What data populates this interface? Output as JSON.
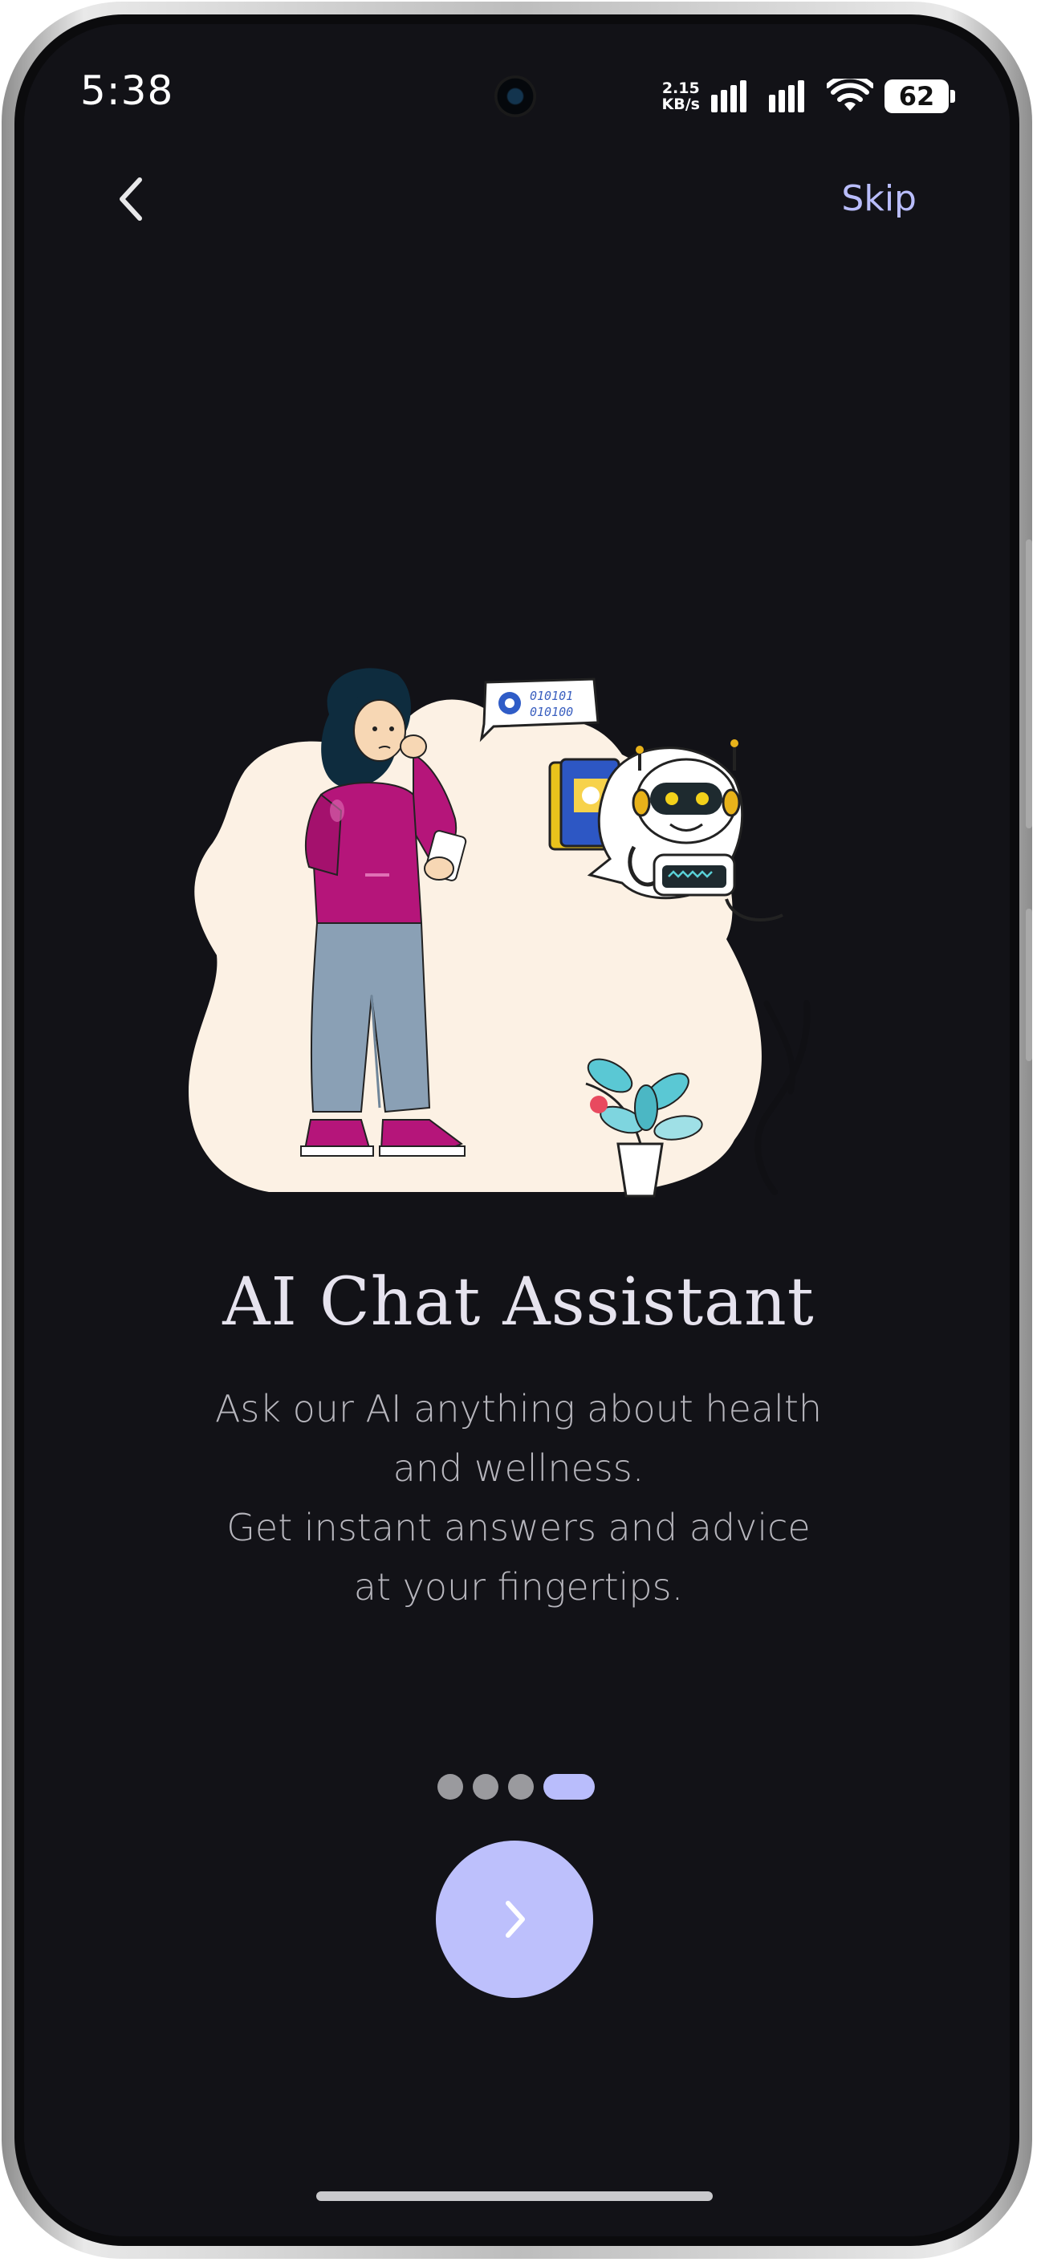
{
  "status_bar": {
    "time": "5:38",
    "net_speed_value": "2.15",
    "net_speed_unit": "KB/s",
    "battery": "62"
  },
  "header": {
    "skip_label": "Skip"
  },
  "onboarding": {
    "title": "AI Chat Assistant",
    "description": "Ask our AI anything about health and wellness.\nGet instant answers and advice at your fingertips.",
    "description_lines": [
      "Ask our AI anything about health",
      "and wellness.",
      "Get instant answers and advice",
      "at your fingertips."
    ],
    "illustration_bubble_lines": [
      "010101",
      "010100"
    ],
    "page_count": 4,
    "current_page": 4
  },
  "colors": {
    "background": "#121217",
    "accent": "#b9bdfc",
    "title": "#e6e3ee",
    "body_text": "#b7b6bd",
    "inactive_dot": "#9a9a9e"
  },
  "icons": {
    "back": "chevron-left-icon",
    "next": "chevron-right-icon"
  }
}
